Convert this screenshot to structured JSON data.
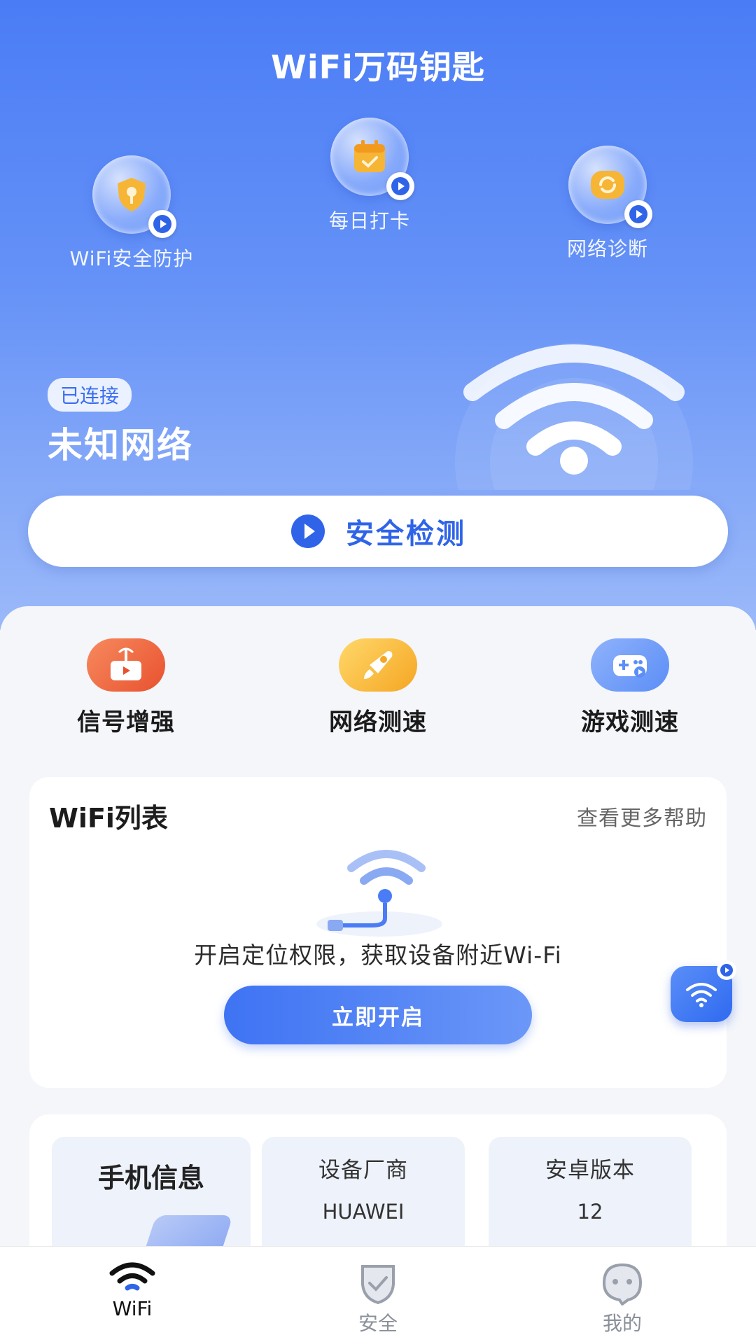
{
  "app": {
    "title": "WiFi万码钥匙"
  },
  "features": [
    {
      "label": "WiFi安全防护",
      "icon": "shield-key-icon"
    },
    {
      "label": "每日打卡",
      "icon": "calendar-check-icon"
    },
    {
      "label": "网络诊断",
      "icon": "refresh-diagnose-icon"
    }
  ],
  "connection": {
    "status": "已连接",
    "network_name": "未知网络"
  },
  "scan_button": {
    "label": "安全检测",
    "icon": "play-circle-icon"
  },
  "tools": [
    {
      "label": "信号增强",
      "icon": "signal-tower-icon",
      "color": "#f0603a"
    },
    {
      "label": "网络测速",
      "icon": "rocket-icon",
      "color": "#f5b52a"
    },
    {
      "label": "游戏测速",
      "icon": "gamepad-icon",
      "color": "#5b8ef6"
    }
  ],
  "wifi_list": {
    "title": "WiFi列表",
    "help_link": "查看更多帮助",
    "message": "开启定位权限，获取设备附近Wi-Fi",
    "button": "立即开启"
  },
  "phone_info": {
    "title": "手机信息",
    "items": [
      {
        "label": "设备厂商",
        "value": "HUAWEI"
      },
      {
        "label": "安卓版本",
        "value": "12"
      }
    ]
  },
  "tabbar": {
    "items": [
      {
        "label": "WiFi",
        "icon": "wifi-icon",
        "active": true
      },
      {
        "label": "安全",
        "icon": "shield-check-icon",
        "active": false
      },
      {
        "label": "我的",
        "icon": "profile-face-icon",
        "active": false
      }
    ]
  },
  "colors": {
    "primary": "#3b6ef0",
    "hero_top": "#4a7cf6",
    "hero_bottom": "#9bb9f9"
  }
}
